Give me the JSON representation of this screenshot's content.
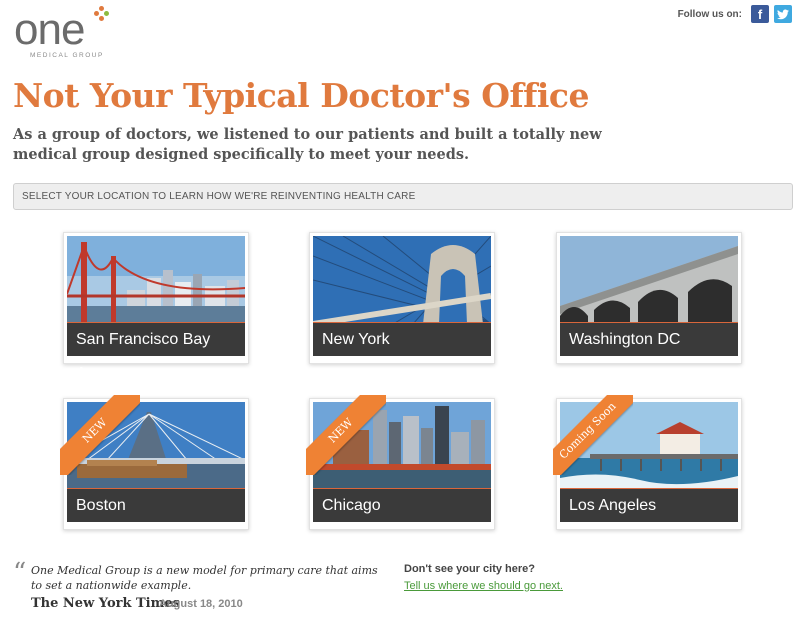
{
  "header": {
    "logo_word": "one",
    "logo_sub": "MEDICAL GROUP",
    "follow_label": "Follow us on:",
    "social": {
      "facebook_icon": "facebook-icon",
      "twitter_icon": "twitter-icon"
    },
    "headline": "Not Your Typical Doctor's Office",
    "subhead": "As a group of doctors, we listened to our patients and built a totally new medical group designed specifically to meet your needs."
  },
  "location_bar": {
    "label": "SELECT YOUR LOCATION TO LEARN HOW WE'RE REINVENTING HEALTH CARE"
  },
  "cities": [
    {
      "name": "San Francisco Bay Area",
      "ribbon": ""
    },
    {
      "name": "New York",
      "ribbon": ""
    },
    {
      "name": "Washington DC",
      "ribbon": ""
    },
    {
      "name": "Boston",
      "ribbon": "NEW"
    },
    {
      "name": "Chicago",
      "ribbon": "NEW"
    },
    {
      "name": "Los Angeles",
      "ribbon": "Coming Soon"
    }
  ],
  "footer": {
    "quote": "One Medical Group is a new model for primary care that aims to set a nationwide example.",
    "source": "The New York Times",
    "date": "August 18, 2010",
    "cta_title": "Don't see your city here?",
    "cta_link": "Tell us where we should go next."
  },
  "colors": {
    "accent": "#e07a3e",
    "ribbon": "#ef8234",
    "label_bg": "#3a3a3a",
    "link": "#4a9a3a"
  }
}
